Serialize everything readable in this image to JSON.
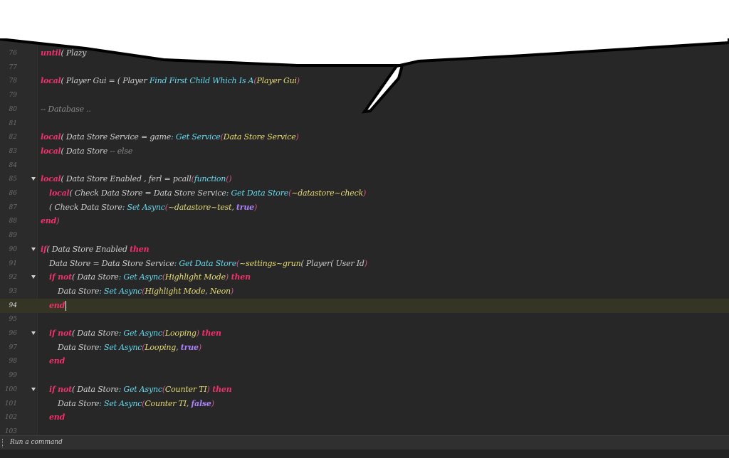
{
  "editor": {
    "lines": [
      {
        "n": "76",
        "segs": [
          [
            "kw",
            "until"
          ],
          [
            "t",
            "( Plazy"
          ]
        ]
      },
      {
        "n": "77",
        "segs": []
      },
      {
        "n": "78",
        "segs": [
          [
            "kw",
            "local"
          ],
          [
            "t",
            "( Player Gui = "
          ],
          [
            "t",
            "( Player "
          ],
          [
            "fn",
            "Find First Child Which Is A"
          ],
          [
            "br",
            "("
          ],
          [
            "str",
            "Player Gui"
          ],
          [
            "br",
            ")"
          ]
        ]
      },
      {
        "n": "79",
        "segs": []
      },
      {
        "n": "80",
        "segs": [
          [
            "cm",
            "-- Database .."
          ]
        ]
      },
      {
        "n": "81",
        "segs": []
      },
      {
        "n": "82",
        "segs": [
          [
            "kw",
            "local"
          ],
          [
            "t",
            "( Data Store Service = game"
          ],
          [
            "fn",
            ": Get Service"
          ],
          [
            "br",
            "("
          ],
          [
            "str",
            "Data Store Service"
          ],
          [
            "br",
            ")"
          ]
        ]
      },
      {
        "n": "83",
        "segs": [
          [
            "kw",
            "local"
          ],
          [
            "t",
            "( Data Store "
          ],
          [
            "cm",
            "-- else"
          ]
        ]
      },
      {
        "n": "84",
        "segs": []
      },
      {
        "n": "85",
        "fold": true,
        "segs": [
          [
            "kw",
            "local"
          ],
          [
            "t",
            "( Data Store Enabled , ferl = pcall"
          ],
          [
            "br",
            "("
          ],
          [
            "fn",
            "function"
          ],
          [
            "br",
            "()"
          ]
        ]
      },
      {
        "n": "86",
        "indent": 1,
        "segs": [
          [
            "kw",
            "local"
          ],
          [
            "t",
            "( Check Data Store = Data Store Service"
          ],
          [
            "fn",
            ": Get Data Store"
          ],
          [
            "br",
            "("
          ],
          [
            "str",
            "~datastore~check"
          ],
          [
            "br",
            ")"
          ]
        ]
      },
      {
        "n": "87",
        "indent": 1,
        "segs": [
          [
            "t",
            "( Check Data Store"
          ],
          [
            "fn",
            ": Set Async"
          ],
          [
            "br",
            "("
          ],
          [
            "str",
            "~datastore~test"
          ],
          [
            "t",
            ", "
          ],
          [
            "bool",
            "true"
          ],
          [
            "br",
            ")"
          ]
        ]
      },
      {
        "n": "88",
        "segs": [
          [
            "kw",
            "end"
          ],
          [
            "br",
            ")"
          ]
        ]
      },
      {
        "n": "89",
        "segs": []
      },
      {
        "n": "90",
        "fold": true,
        "segs": [
          [
            "kw",
            "if"
          ],
          [
            "t",
            "( Data Store Enabled "
          ],
          [
            "kw",
            "then"
          ]
        ]
      },
      {
        "n": "91",
        "indent": 1,
        "segs": [
          [
            "t",
            "Data Store = Data Store Service"
          ],
          [
            "fn",
            ": Get Data Store"
          ],
          [
            "br",
            "("
          ],
          [
            "str",
            "~settings~grun"
          ],
          [
            "t",
            "( Player"
          ],
          [
            "t",
            "( User Id"
          ],
          [
            "br",
            ")"
          ]
        ]
      },
      {
        "n": "92",
        "fold": true,
        "indent": 1,
        "segs": [
          [
            "kw",
            "if not"
          ],
          [
            "t",
            "( Data Store"
          ],
          [
            "fn",
            ": Get Async"
          ],
          [
            "br",
            "("
          ],
          [
            "str",
            "Highlight Mode"
          ],
          [
            "br",
            ")"
          ],
          [
            "kw",
            " then"
          ]
        ]
      },
      {
        "n": "93",
        "indent": 2,
        "segs": [
          [
            "t",
            "Data Store"
          ],
          [
            "fn",
            ": Set Async"
          ],
          [
            "br",
            "("
          ],
          [
            "str",
            "Highlight Mode"
          ],
          [
            "t",
            ", "
          ],
          [
            "str",
            "Neon"
          ],
          [
            "br",
            ")"
          ]
        ]
      },
      {
        "n": "94",
        "indent": 1,
        "current": true,
        "caret": true,
        "segs": [
          [
            "kw",
            "end"
          ]
        ]
      },
      {
        "n": "95",
        "segs": []
      },
      {
        "n": "96",
        "fold": true,
        "indent": 1,
        "segs": [
          [
            "kw",
            "if not"
          ],
          [
            "t",
            "( Data Store"
          ],
          [
            "fn",
            ": Get Async"
          ],
          [
            "br",
            "("
          ],
          [
            "str",
            "Looping"
          ],
          [
            "br",
            ")"
          ],
          [
            "kw",
            " then"
          ]
        ]
      },
      {
        "n": "97",
        "indent": 2,
        "segs": [
          [
            "t",
            "Data Store"
          ],
          [
            "fn",
            ": Set Async"
          ],
          [
            "br",
            "("
          ],
          [
            "str",
            "Looping"
          ],
          [
            "t",
            ", "
          ],
          [
            "bool",
            "true"
          ],
          [
            "br",
            ")"
          ]
        ]
      },
      {
        "n": "98",
        "indent": 1,
        "segs": [
          [
            "kw",
            "end"
          ]
        ]
      },
      {
        "n": "99",
        "segs": []
      },
      {
        "n": "100",
        "fold": true,
        "indent": 1,
        "segs": [
          [
            "kw",
            "if not"
          ],
          [
            "t",
            "( Data Store"
          ],
          [
            "fn",
            ": Get Async"
          ],
          [
            "br",
            "("
          ],
          [
            "str",
            "Counter TI"
          ],
          [
            "br",
            ")"
          ],
          [
            "kw",
            " then"
          ]
        ]
      },
      {
        "n": "101",
        "indent": 2,
        "segs": [
          [
            "t",
            "Data Store"
          ],
          [
            "fn",
            ": Set Async"
          ],
          [
            "br",
            "("
          ],
          [
            "str",
            "Counter TI"
          ],
          [
            "t",
            ", "
          ],
          [
            "bool",
            "false"
          ],
          [
            "br",
            ")"
          ]
        ]
      },
      {
        "n": "102",
        "indent": 1,
        "segs": [
          [
            "kw",
            "end"
          ]
        ]
      },
      {
        "n": "103",
        "segs": []
      }
    ]
  },
  "statusbar": {
    "command_placeholder": "Run a command"
  },
  "colors": {
    "editor_bg": "#272727",
    "keyword": "#f0306b",
    "function": "#66d9ef",
    "string": "#e6db74",
    "boolean": "#ae81ff"
  }
}
